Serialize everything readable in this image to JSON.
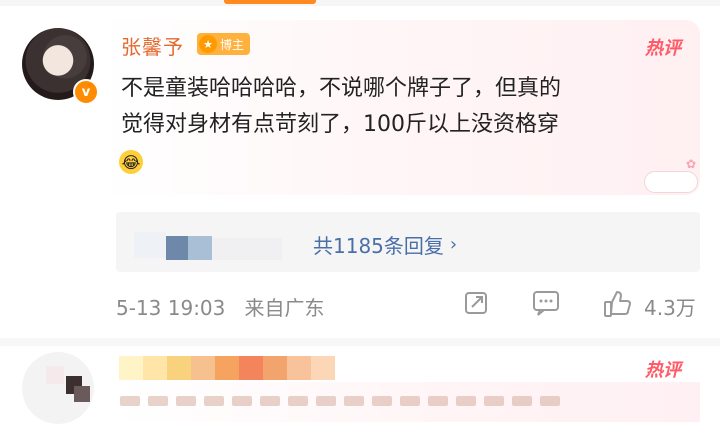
{
  "comment1": {
    "username": "张馨予",
    "host_badge_label": "博主",
    "hot_label": "热评",
    "text_lines": [
      "不是童装哈哈哈哈，不说哪个牌子了，但真的",
      "觉得对身材有点苛刻了，100斤以上没资格穿"
    ],
    "emoji_icon": "crying-laughing-emoji",
    "replies_label": "共1185条回复",
    "timestamp": "5-13 19:03",
    "location": "来自广东",
    "likes": "4.3万"
  },
  "comment2": {
    "hot_label": "热评",
    "name_blur_colors": [
      "#fff4c8",
      "#ffe6a8",
      "#f9d27d",
      "#f7c08f",
      "#f6a35f",
      "#f4845b",
      "#f2a46c",
      "#f8c29a",
      "#fbd6b7"
    ]
  },
  "colors": {
    "accent_orange": "#ff8c00",
    "hot_red": "#ff5a67",
    "link_blue": "#4a6fa8"
  }
}
